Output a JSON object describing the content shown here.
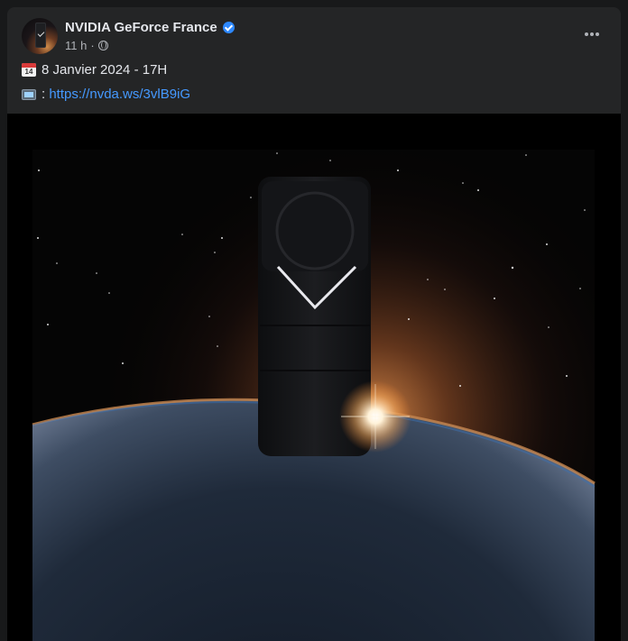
{
  "post": {
    "author": "NVIDIA GeForce France",
    "time": "11 h",
    "separator": "·",
    "line1_text": "8 Janvier 2024 - 17H",
    "line2_prefix": ":",
    "link": "https://nvda.ws/3vlB9iG"
  },
  "icons": {
    "verified": "verified-badge-icon",
    "audience": "globe-icon",
    "more": "more-options-icon",
    "calendar": "calendar-emoji-icon",
    "tv": "television-emoji-icon"
  },
  "colors": {
    "background": "#18191a",
    "card": "#242526",
    "text": "#e4e6eb",
    "secondary": "#b0b3b8",
    "link": "#4599ff",
    "verified": "#2d88ff"
  }
}
